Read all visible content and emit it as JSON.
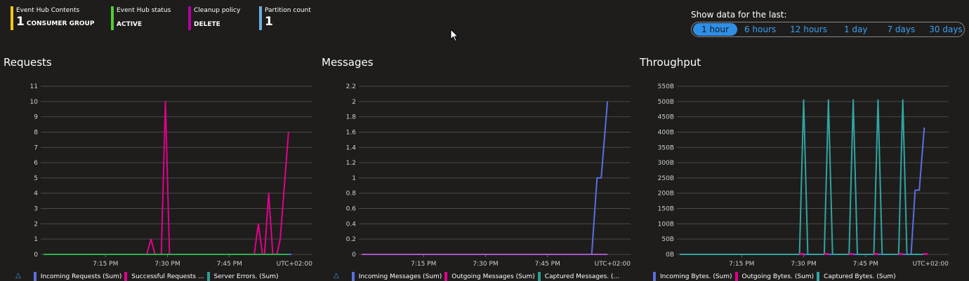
{
  "tiles": [
    {
      "label": "Event Hub Contents",
      "value": "1",
      "unit": "CONSUMER GROUP",
      "color": "#f2c811"
    },
    {
      "label": "Event Hub status",
      "value": "",
      "unit": "ACTIVE",
      "color": "#4fce2f"
    },
    {
      "label": "Cleanup policy",
      "value": "",
      "unit": "DELETE",
      "color": "#b4009e"
    },
    {
      "label": "Partition count",
      "value": "1",
      "unit": "",
      "color": "#69afe5"
    }
  ],
  "time_range": {
    "label": "Show data for the last:",
    "options": [
      "1 hour",
      "6 hours",
      "12 hours",
      "1 day",
      "7 days",
      "30 days"
    ],
    "selected": "1 hour"
  },
  "panels": [
    {
      "title": "Requests"
    },
    {
      "title": "Messages"
    },
    {
      "title": "Throughput"
    }
  ],
  "chart_data": [
    {
      "type": "line",
      "title": "Requests",
      "x_ticks": [
        "7:15 PM",
        "7:30 PM",
        "7:45 PM"
      ],
      "timezone": "UTC+02:00",
      "ylim": [
        0,
        11
      ],
      "y_ticks": [
        "0",
        "1",
        "2",
        "3",
        "4",
        "5",
        "6",
        "7",
        "8",
        "9",
        "10",
        "11"
      ],
      "x_range_minutes": [
        0,
        60
      ],
      "series": [
        {
          "name": "Incoming Requests (Sum)",
          "color": "#5b6ee1",
          "points": [
            [
              0,
              0
            ],
            [
              60,
              0
            ]
          ]
        },
        {
          "name": "Successful Requests ...",
          "color": "#e3008c",
          "points": [
            [
              0,
              0
            ],
            [
              25,
              0
            ],
            [
              26,
              1
            ],
            [
              27,
              0
            ],
            [
              28.5,
              0
            ],
            [
              29.5,
              10
            ],
            [
              30.5,
              0
            ],
            [
              51,
              0
            ],
            [
              52,
              2
            ],
            [
              53,
              0
            ],
            [
              53.5,
              0
            ],
            [
              54.5,
              4
            ],
            [
              55.5,
              0
            ],
            [
              56.5,
              0
            ],
            [
              57.3,
              1
            ],
            [
              59.3,
              8
            ]
          ]
        },
        {
          "name": "Server Errors. (Sum)",
          "color": "#2bb24c",
          "points": [
            [
              0,
              0
            ],
            [
              59.3,
              0
            ]
          ]
        }
      ],
      "legend_colors": [
        "#5b6ee1",
        "#e3008c",
        "#2d9e8f"
      ]
    },
    {
      "type": "line",
      "title": "Messages",
      "x_ticks": [
        "7:15 PM",
        "7:30 PM",
        "7:45 PM"
      ],
      "timezone": "UTC+02:00",
      "ylim": [
        0,
        2.2
      ],
      "y_ticks": [
        "0",
        "0.2",
        "0.4",
        "0.6",
        "0.8",
        "1",
        "1.2",
        "1.4",
        "1.6",
        "1.8",
        "2",
        "2.2"
      ],
      "x_range_minutes": [
        0,
        60
      ],
      "series": [
        {
          "name": "Incoming Messages (Sum)",
          "color": "#5b6ee1",
          "points": [
            [
              0,
              0
            ],
            [
              55.7,
              0
            ],
            [
              57,
              1
            ],
            [
              58,
              1
            ],
            [
              59.5,
              2
            ]
          ]
        },
        {
          "name": "Outgoing Messages (Sum)",
          "color": "#e3008c",
          "points": [
            [
              0,
              0
            ],
            [
              59.5,
              0
            ]
          ]
        },
        {
          "name": "Captured Messages. (...",
          "color": "#a855c8",
          "points": [
            [
              0,
              0
            ],
            [
              59.5,
              0
            ]
          ]
        }
      ],
      "legend_colors": [
        "#5b6ee1",
        "#e3008c",
        "#2d9e8f"
      ]
    },
    {
      "type": "line",
      "title": "Throughput",
      "x_ticks": [
        "7:15 PM",
        "7:30 PM",
        "7:45 PM"
      ],
      "timezone": "UTC+02:00",
      "ylim": [
        0,
        550
      ],
      "y_ticks": [
        "0B",
        "50B",
        "100B",
        "150B",
        "200B",
        "250B",
        "300B",
        "350B",
        "400B",
        "450B",
        "500B",
        "550B"
      ],
      "x_range_minutes": [
        0,
        60
      ],
      "series": [
        {
          "name": "Incoming Bytes. (Sum)",
          "color": "#5b6ee1",
          "points": [
            [
              0,
              0
            ],
            [
              56,
              0
            ],
            [
              57,
              210
            ],
            [
              58,
              210
            ],
            [
              59.2,
              415
            ]
          ]
        },
        {
          "name": "Outgoing Bytes. (Sum)",
          "color": "#e3008c",
          "points": []
        },
        {
          "name": "Captured Bytes. (Sum)",
          "color": "#2fa6a0",
          "points": [
            [
              0,
              0
            ],
            [
              29,
              0
            ],
            [
              30,
              505
            ],
            [
              31,
              0
            ],
            [
              35,
              0
            ],
            [
              36,
              505
            ],
            [
              37,
              0
            ],
            [
              41,
              0
            ],
            [
              42,
              505
            ],
            [
              43,
              0
            ],
            [
              47,
              0
            ],
            [
              48,
              505
            ],
            [
              49,
              0
            ],
            [
              53,
              0
            ],
            [
              54,
              505
            ],
            [
              55,
              0
            ],
            [
              59,
              0
            ]
          ]
        }
      ],
      "outgoing_markers_minutes": [
        29.5,
        35.5,
        41.5,
        47.5,
        53.5,
        59.5
      ],
      "legend_colors": [
        "#5b6ee1",
        "#e3008c",
        "#2fa6a0"
      ]
    }
  ]
}
